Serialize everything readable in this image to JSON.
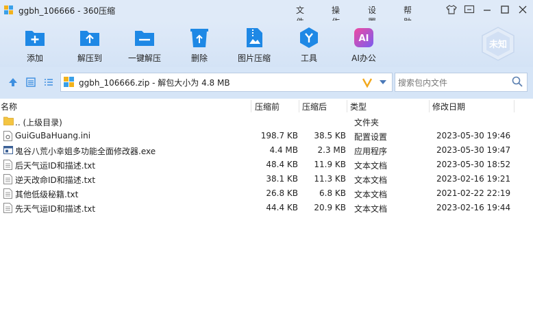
{
  "window": {
    "title": "ggbh_106666 - 360压缩"
  },
  "menu": {
    "file": "文件",
    "operate": "操作",
    "settings": "设置",
    "help": "帮助"
  },
  "toolbar": {
    "add": "添加",
    "extract_to": "解压到",
    "one_click_extract": "一键解压",
    "delete": "删除",
    "image_compress": "图片压缩",
    "tools": "工具",
    "ai_office": "AI办公",
    "ai_icon_text": "AI",
    "badge_text": "未知"
  },
  "address": {
    "path": "ggbh_106666.zip - 解包大小为 4.8 MB"
  },
  "search": {
    "placeholder": "搜索包内文件"
  },
  "columns": {
    "name": "名称",
    "compressed_before": "压缩前",
    "compressed_after": "压缩后",
    "type": "类型",
    "modified": "修改日期"
  },
  "files": [
    {
      "name": ".. (上级目录)",
      "before": "",
      "after": "",
      "type": "文件夹",
      "date": "",
      "icon": "folder-icon"
    },
    {
      "name": "GuiGuBaHuang.ini",
      "before": "198.7 KB",
      "after": "38.5 KB",
      "type": "配置设置",
      "date": "2023-05-30 19:46",
      "icon": "settings-file-icon"
    },
    {
      "name": "鬼谷八荒小幸姐多功能全面修改器.exe",
      "before": "4.4 MB",
      "after": "2.3 MB",
      "type": "应用程序",
      "date": "2023-05-30 19:47",
      "icon": "application-icon"
    },
    {
      "name": "后天气运ID和描述.txt",
      "before": "48.4 KB",
      "after": "11.9 KB",
      "type": "文本文档",
      "date": "2023-05-30 18:52",
      "icon": "text-file-icon"
    },
    {
      "name": "逆天改命ID和描述.txt",
      "before": "38.1 KB",
      "after": "11.3 KB",
      "type": "文本文档",
      "date": "2023-02-16 19:21",
      "icon": "text-file-icon"
    },
    {
      "name": "其他低级秘籍.txt",
      "before": "26.8 KB",
      "after": "6.8 KB",
      "type": "文本文档",
      "date": "2021-02-22 22:19",
      "icon": "text-file-icon"
    },
    {
      "name": "先天气运ID和描述.txt",
      "before": "44.4 KB",
      "after": "20.9 KB",
      "type": "文本文档",
      "date": "2023-02-16 19:44",
      "icon": "text-file-icon"
    }
  ],
  "colors": {
    "titlebar": "#dfeaf8",
    "toolbar": "#d4e3f6",
    "accent_blue": "#2a8ee8",
    "ai_pink": "#e83a8e"
  }
}
